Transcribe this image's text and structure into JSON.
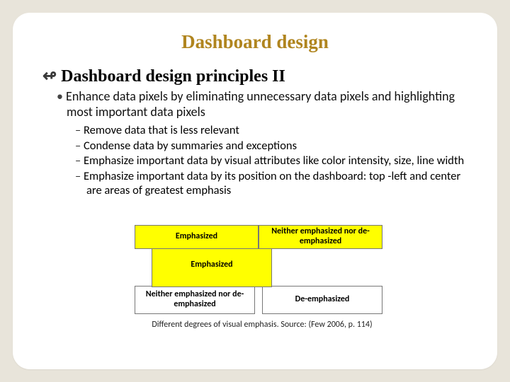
{
  "title": "Dashboard design",
  "subtitle_bullet": "ʃ",
  "subtitle": "Dashboard design principles II",
  "main_point": "Enhance data pixels by eliminating unnecessary data pixels and highlighting most important data pixels",
  "sub_points": [
    "Remove data that is less relevant",
    "Condense data by summaries and exceptions",
    "Emphasize important data by visual attributes like color intensity, size, line width",
    "Emphasize important data by its position on the dashboard: top -left and center are areas of greatest emphasis"
  ],
  "diagram": {
    "row1": [
      "Emphasized",
      "Neither emphasized nor de-emphasized"
    ],
    "row2": "Emphasized",
    "row3": [
      "Neither emphasized nor de-emphasized",
      "De-emphasized"
    ]
  },
  "caption": "Different degrees of visual emphasis. Source: (Few 2006, p. 114)"
}
